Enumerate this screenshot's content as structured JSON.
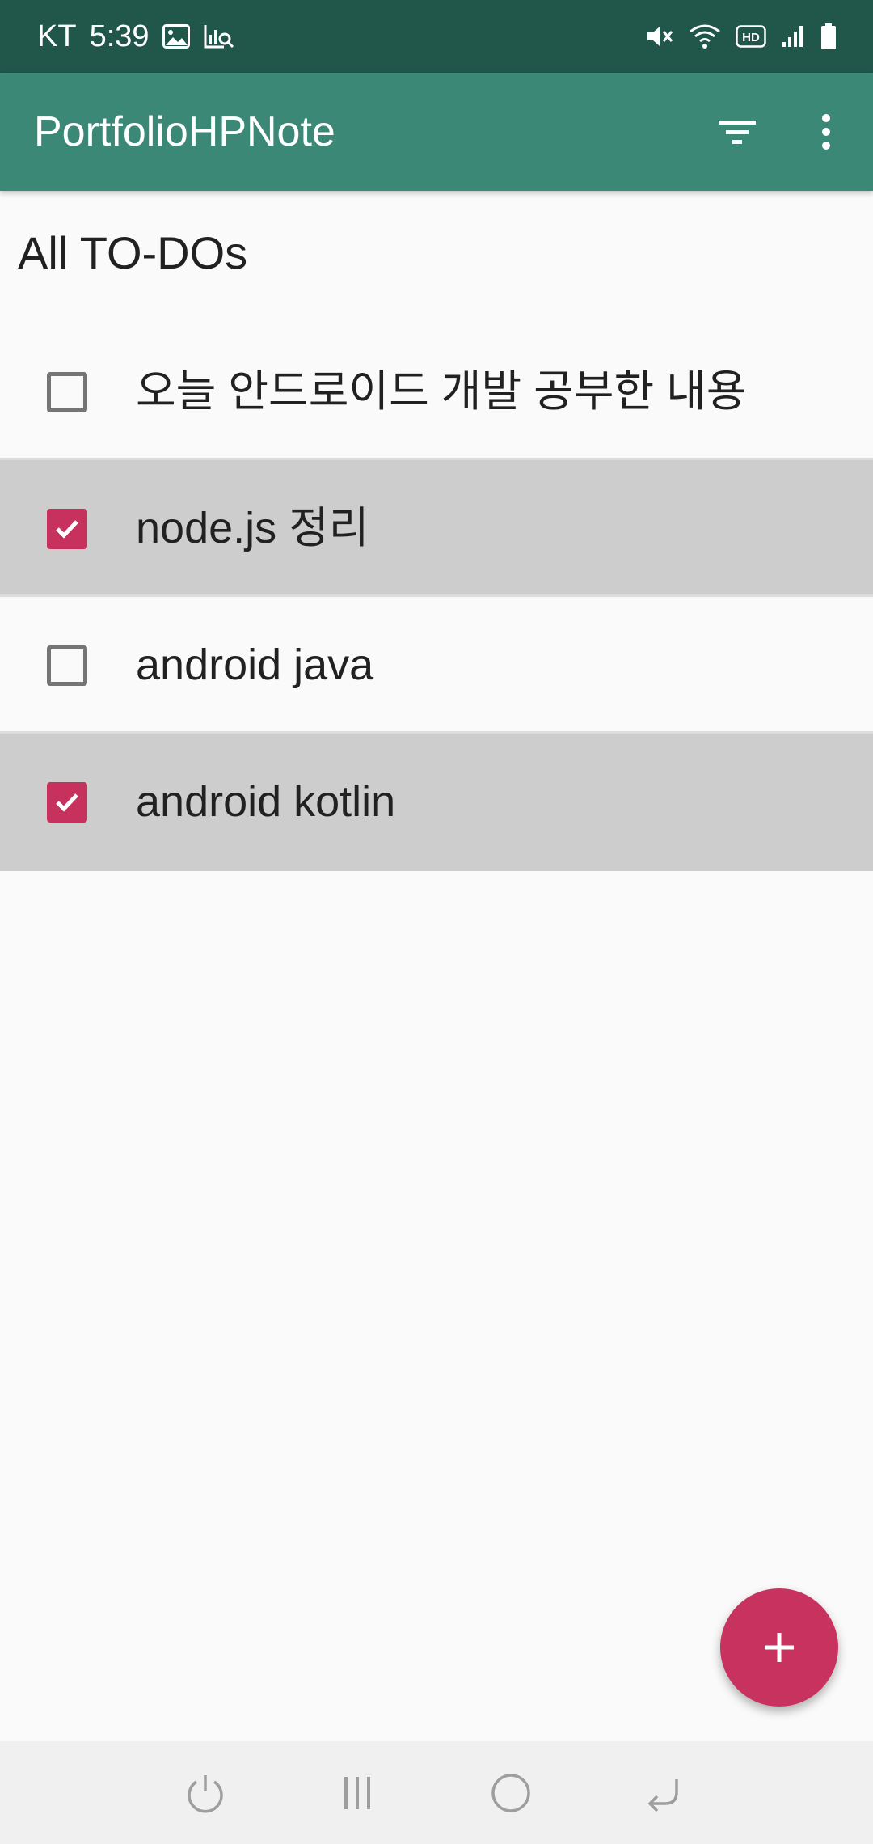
{
  "status_bar": {
    "carrier": "KT",
    "time": "5:39",
    "left_icons": [
      "image-icon",
      "chart-search-icon"
    ],
    "right_icons": [
      "mute-icon",
      "wifi-icon",
      "hd-icon",
      "signal-icon",
      "battery-icon"
    ],
    "hd_label": "HD"
  },
  "app_bar": {
    "title": "PortfolioHPNote",
    "actions": [
      "filter-icon",
      "more-vert-icon"
    ]
  },
  "list": {
    "heading": "All TO-DOs",
    "items": [
      {
        "text": "오늘 안드로이드 개발 공부한 내용",
        "checked": false
      },
      {
        "text": "node.js 정리",
        "checked": true
      },
      {
        "text": "android java",
        "checked": false
      },
      {
        "text": "android kotlin",
        "checked": true
      }
    ]
  },
  "fab": {
    "icon": "add-icon"
  },
  "nav_bar": {
    "buttons": [
      "power-icon",
      "recents-icon",
      "home-icon",
      "back-icon"
    ]
  },
  "colors": {
    "status_bar": "#21564b",
    "app_bar": "#3b8877",
    "accent": "#c7315e",
    "checked_row": "#cdcdcd"
  }
}
